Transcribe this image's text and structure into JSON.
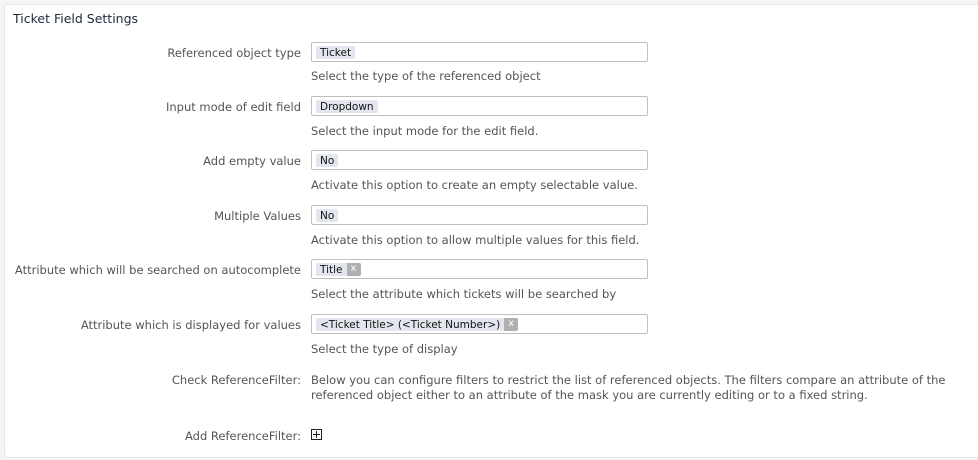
{
  "panel": {
    "title": "Ticket Field Settings"
  },
  "fields": [
    {
      "label": "Referenced object type",
      "value": "Ticket",
      "hint": "Select the type of the referenced object",
      "removable": false
    },
    {
      "label": "Input mode of edit field",
      "value": "Dropdown",
      "hint": "Select the input mode for the edit field.",
      "removable": false
    },
    {
      "label": "Add empty value",
      "value": "No",
      "hint": "Activate this option to create an empty selectable value.",
      "removable": false
    },
    {
      "label": "Multiple Values",
      "value": "No",
      "hint": "Activate this option to allow multiple values for this field.",
      "removable": false
    },
    {
      "label": "Attribute which will be searched on autocomplete",
      "value": "Title",
      "hint": "Select the attribute which tickets will be searched by",
      "removable": true,
      "remove_label": "x"
    },
    {
      "label": "Attribute which is displayed for values",
      "value": "<Ticket Title> (<Ticket Number>)",
      "hint": "Select the type of display",
      "removable": true,
      "remove_label": "x"
    }
  ],
  "reference_filter": {
    "label": "Check ReferenceFilter:",
    "description": "Below you can configure filters to restrict the list of referenced objects. The filters compare an attribute of the referenced object either to an attribute of the mask you are currently editing or to a fixed string."
  },
  "add_filter": {
    "label": "Add ReferenceFilter:"
  }
}
